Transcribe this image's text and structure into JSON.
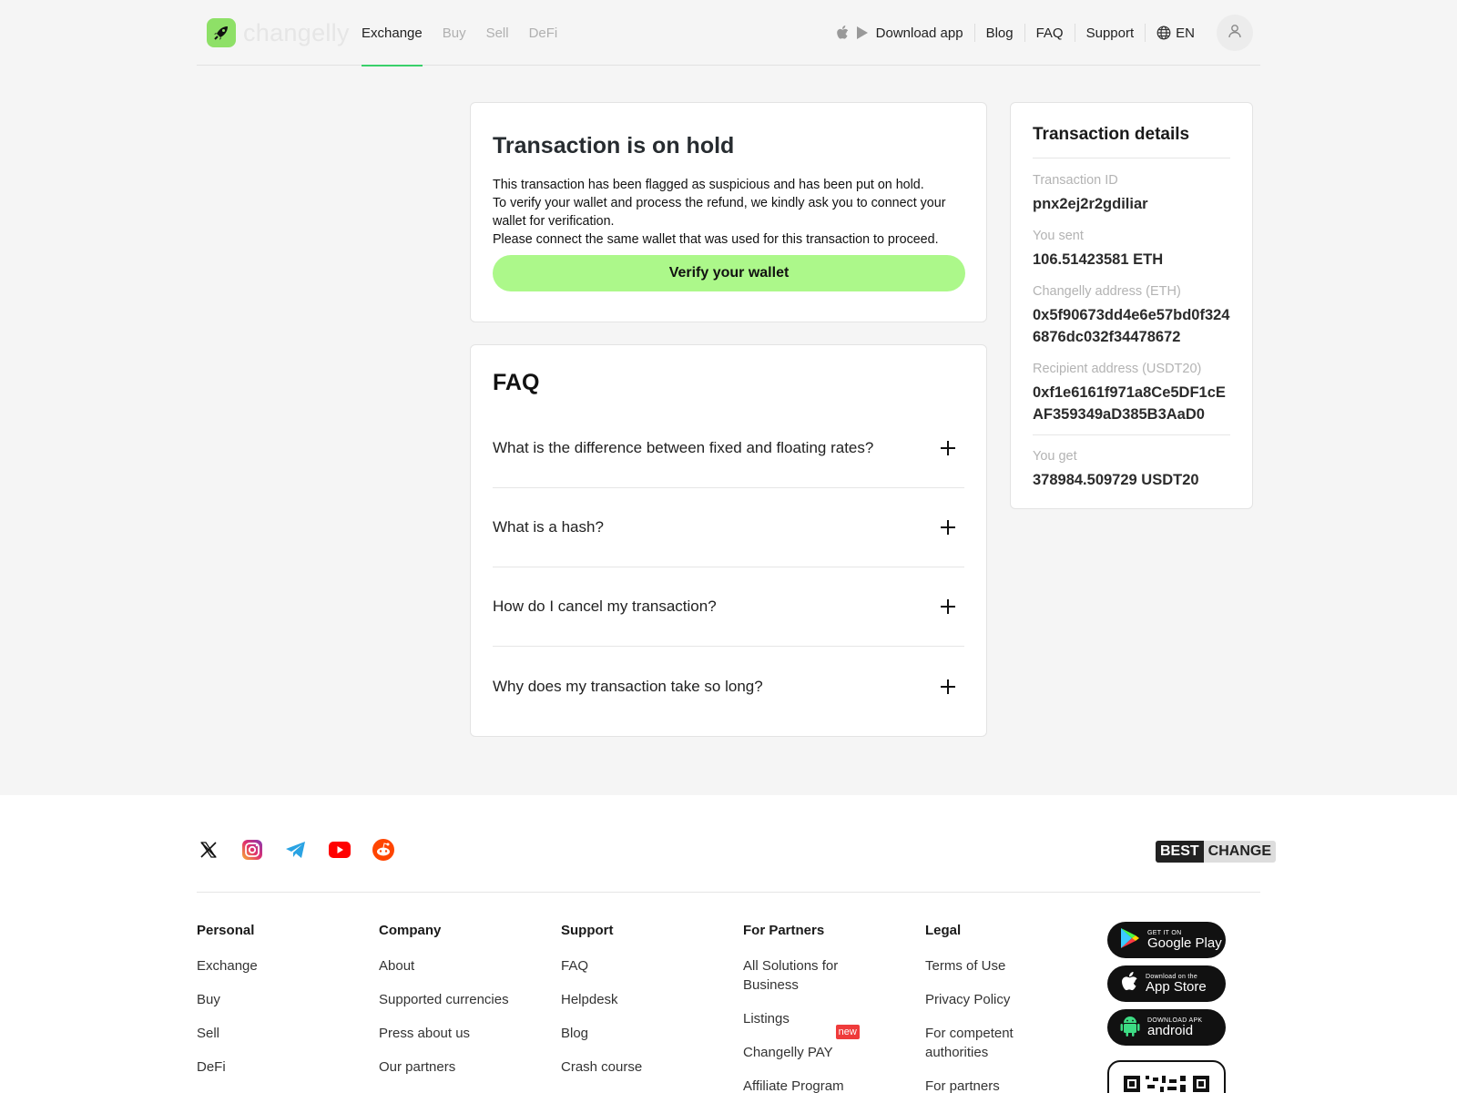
{
  "header": {
    "logo_text": "changelly",
    "nav": [
      "Exchange",
      "Buy",
      "Sell",
      "DeFi"
    ],
    "download_app": "Download app",
    "links": [
      "Blog",
      "FAQ",
      "Support"
    ],
    "language": "EN"
  },
  "hold": {
    "title": "Transaction is on hold",
    "text": "This transaction has been flagged as suspicious and has been put on hold.\nTo verify your wallet and process the refund, we kindly ask you to connect your wallet for verification.\nPlease connect the same wallet that was used for this transaction to proceed.",
    "button": "Verify your wallet"
  },
  "faq": {
    "title": "FAQ",
    "items": [
      "What is the difference between fixed and floating rates?",
      "What is a hash?",
      "How do I cancel my transaction?",
      "Why does my transaction take so long?"
    ]
  },
  "details": {
    "title": "Transaction details",
    "transaction_id_label": "Transaction ID",
    "transaction_id": "pnx2ej2r2gdiliar",
    "sent_label": "You sent",
    "sent": "106.51423581 ETH",
    "changelly_address_label": "Changelly address (ETH)",
    "changelly_address": "0x5f90673dd4e6e57bd0f3246876dc032f34478672",
    "recipient_label": "Recipient address (USDT20)",
    "recipient_address": "0xf1e6161f971a8Ce5DF1cEAF359349aD385B3AaD0",
    "get_label": "You get",
    "get": "378984.509729 USDT20"
  },
  "footer": {
    "bestchange_a": "BEST",
    "bestchange_b": "CHANGE",
    "columns": [
      {
        "title": "Personal",
        "links": [
          "Exchange",
          "Buy",
          "Sell",
          "DeFi"
        ]
      },
      {
        "title": "Company",
        "links": [
          "About",
          "Supported currencies",
          "Press about us",
          "Our partners"
        ]
      },
      {
        "title": "Support",
        "links": [
          "FAQ",
          "Helpdesk",
          "Blog",
          "Crash course"
        ]
      },
      {
        "title": "For Partners",
        "links": [
          "All Solutions for Business",
          "Listings",
          "Changelly PAY",
          "Affiliate Program"
        ],
        "badge": "new"
      },
      {
        "title": "Legal",
        "links": [
          "Terms of Use",
          "Privacy Policy",
          "For competent authorities",
          "For partners"
        ]
      }
    ],
    "stores": {
      "google_small": "GET IT ON",
      "google_big": "Google Play",
      "apple_small": "Download on the",
      "apple_big": "App Store",
      "android_small": "DOWNLOAD APK",
      "android_big": "android"
    }
  },
  "colors": {
    "accent_green": "#acf88a",
    "nav_underline": "#39d06a",
    "badge_red": "#ef3b3b"
  }
}
